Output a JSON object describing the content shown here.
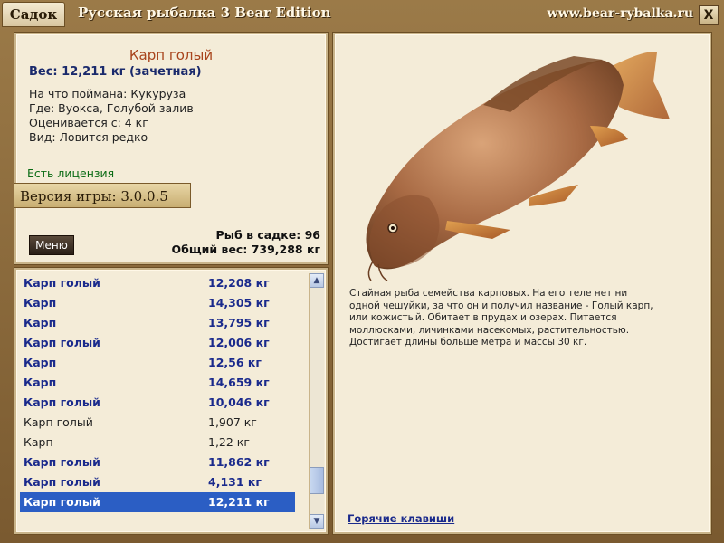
{
  "titlebar": {
    "tab_label": "Садок",
    "app_title": "Русская рыбалка 3 Bear Edition",
    "site_url": "www.bear-rybalka.ru",
    "close_label": "X"
  },
  "info": {
    "fish_name": "Карп голый",
    "weight_line": "Вес: 12,211 кг (зачетная)",
    "bait_line": "На что поймана: Кукуруза",
    "place_line": "Где: Вуокса, Голубой залив",
    "estimate_line": "Оценивается с: 4 кг",
    "kind_line": "Вид: Ловится редко",
    "license": "Есть лицензия",
    "version": "Версия игры: 3.0.0.5",
    "menu_label": "Меню",
    "catch_count": "Рыб в садке: 96",
    "total_weight": "Общий вес: 739,288 кг"
  },
  "catch_list": [
    {
      "name": "Карп голый",
      "weight": "12,208 кг",
      "trophy": true
    },
    {
      "name": "Карп",
      "weight": "14,305 кг",
      "trophy": true
    },
    {
      "name": "Карп",
      "weight": "13,795 кг",
      "trophy": true
    },
    {
      "name": "Карп голый",
      "weight": "12,006 кг",
      "trophy": true
    },
    {
      "name": "Карп",
      "weight": "12,56 кг",
      "trophy": true
    },
    {
      "name": "Карп",
      "weight": "14,659 кг",
      "trophy": true
    },
    {
      "name": "Карп голый",
      "weight": "10,046 кг",
      "trophy": true
    },
    {
      "name": "Карп голый",
      "weight": "1,907 кг",
      "trophy": false
    },
    {
      "name": "Карп",
      "weight": "1,22 кг",
      "trophy": false
    },
    {
      "name": "Карп голый",
      "weight": "11,862 кг",
      "trophy": true
    },
    {
      "name": "Карп голый",
      "weight": "4,131 кг",
      "trophy": true
    },
    {
      "name": "Карп голый",
      "weight": "12,211 кг",
      "trophy": true,
      "selected": true
    }
  ],
  "scrollbar": {
    "up_icon": "arrow-up-icon",
    "down_icon": "arrow-down-icon",
    "position": 0.9
  },
  "detail": {
    "description": "Стайная рыба семейства карповых. На его теле нет ни одной чешуйки, за что он и получил название - Голый карп, или кожистый. Обитает в прудах и озерах. Питается моллюсками, личинками насекомых, растительностью. Достигает длины больше метра и массы 30 кг.",
    "hotkeys": "Горячие клавиши"
  },
  "colors": {
    "trophy_text": "#1a2a8c",
    "selected_bg": "#2b5ec4",
    "fish_name": "#a8441c",
    "license": "#0a6b14"
  }
}
